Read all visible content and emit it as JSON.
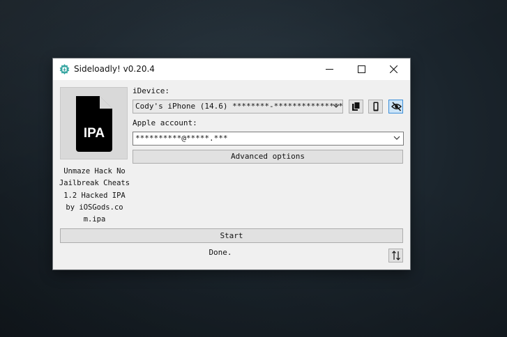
{
  "window": {
    "title": "Sideloadly! v0.20.4",
    "app_icon": "sideloadly-logo-icon",
    "controls": [
      "minimize-icon",
      "maximize-icon",
      "close-icon"
    ]
  },
  "ipa_panel": {
    "icon_label": "IPA",
    "file_name_lines": [
      "Unmaze Hack No",
      "Jailbreak Cheats",
      "1.2 Hacked IPA",
      "by iOSGods.co",
      "m.ipa"
    ]
  },
  "idevice": {
    "label": "iDevice:",
    "selected": "Cody's iPhone (14.6) ********-****************"
  },
  "device_buttons": {
    "copy_icon": "copy-icon",
    "phone_icon": "phone-icon",
    "hide_icon": "eye-slash-icon"
  },
  "apple_account": {
    "label": "Apple account:",
    "value": "**********@*****.***"
  },
  "buttons": {
    "advanced": "Advanced options",
    "start": "Start"
  },
  "status": {
    "text": "Done.",
    "sort_icon": "sort-arrows-icon"
  },
  "colors": {
    "accent": "#3c8fd9",
    "window_bg": "#f0f0f0",
    "logo": "#3aa7a3"
  }
}
